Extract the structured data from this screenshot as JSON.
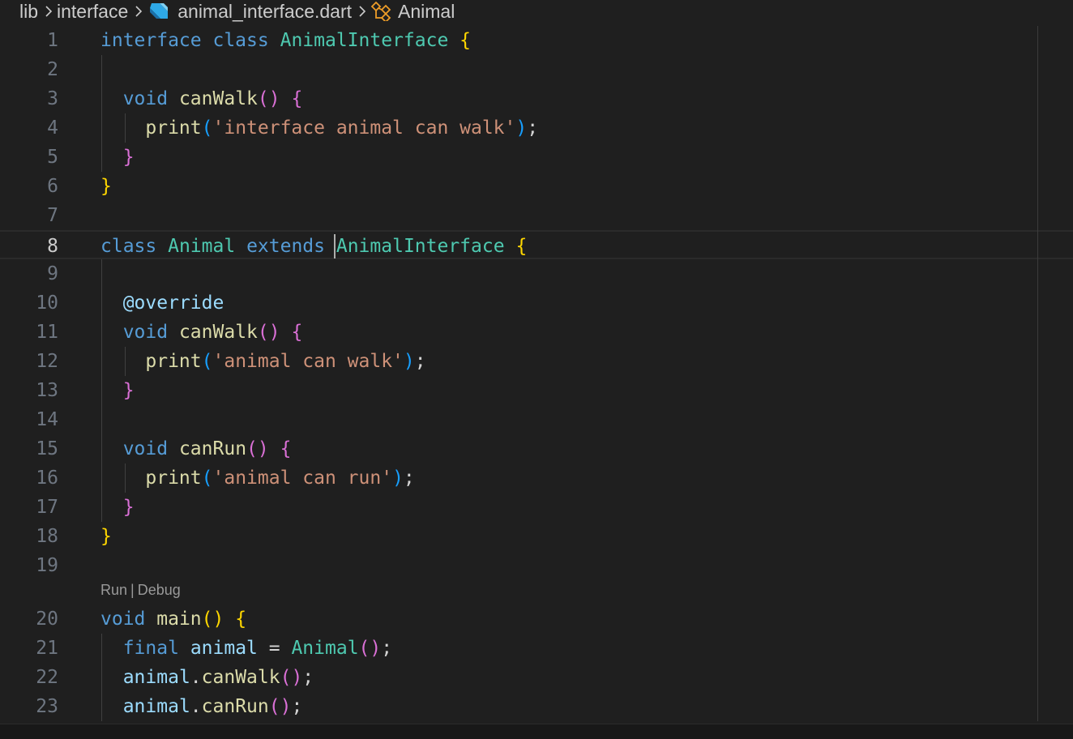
{
  "breadcrumb": {
    "items": [
      "lib",
      "interface",
      "animal_interface.dart",
      "Animal"
    ],
    "file_icon": "dart-file-icon",
    "symbol_icon": "class-symbol-icon",
    "icon_colors": {
      "dart": "#2ea8e6",
      "class": "#ee9d28"
    }
  },
  "editor": {
    "active_line": 8,
    "codelens": {
      "run": "Run",
      "separator": "|",
      "debug": "Debug"
    },
    "lines": [
      {
        "n": 1,
        "tokens": [
          [
            "kw",
            "interface"
          ],
          [
            "plain",
            " "
          ],
          [
            "kw",
            "class"
          ],
          [
            "plain",
            " "
          ],
          [
            "cls",
            "AnimalInterface"
          ],
          [
            "plain",
            " "
          ],
          [
            "b1",
            "{"
          ]
        ]
      },
      {
        "n": 2,
        "tokens": []
      },
      {
        "n": 3,
        "tokens": [
          [
            "plain",
            "  "
          ],
          [
            "kw",
            "void"
          ],
          [
            "plain",
            " "
          ],
          [
            "fn",
            "canWalk"
          ],
          [
            "b2",
            "()"
          ],
          [
            "plain",
            " "
          ],
          [
            "b2",
            "{"
          ]
        ]
      },
      {
        "n": 4,
        "tokens": [
          [
            "plain",
            "    "
          ],
          [
            "fn",
            "print"
          ],
          [
            "b3",
            "("
          ],
          [
            "str",
            "'interface animal can walk'"
          ],
          [
            "b3",
            ")"
          ],
          [
            "plain",
            ";"
          ]
        ]
      },
      {
        "n": 5,
        "tokens": [
          [
            "plain",
            "  "
          ],
          [
            "b2",
            "}"
          ]
        ]
      },
      {
        "n": 6,
        "tokens": [
          [
            "b1",
            "}"
          ]
        ]
      },
      {
        "n": 7,
        "tokens": []
      },
      {
        "n": 8,
        "tokens": [
          [
            "kw",
            "class"
          ],
          [
            "plain",
            " "
          ],
          [
            "cls",
            "Animal"
          ],
          [
            "plain",
            " "
          ],
          [
            "kw",
            "extends"
          ],
          [
            "plain",
            " "
          ],
          [
            "cls",
            "AnimalInterface"
          ],
          [
            "plain",
            " "
          ],
          [
            "b1",
            "{"
          ]
        ]
      },
      {
        "n": 9,
        "tokens": []
      },
      {
        "n": 10,
        "tokens": [
          [
            "plain",
            "  "
          ],
          [
            "ann",
            "@override"
          ]
        ]
      },
      {
        "n": 11,
        "tokens": [
          [
            "plain",
            "  "
          ],
          [
            "kw",
            "void"
          ],
          [
            "plain",
            " "
          ],
          [
            "fn",
            "canWalk"
          ],
          [
            "b2",
            "()"
          ],
          [
            "plain",
            " "
          ],
          [
            "b2",
            "{"
          ]
        ]
      },
      {
        "n": 12,
        "tokens": [
          [
            "plain",
            "    "
          ],
          [
            "fn",
            "print"
          ],
          [
            "b3",
            "("
          ],
          [
            "str",
            "'animal can walk'"
          ],
          [
            "b3",
            ")"
          ],
          [
            "plain",
            ";"
          ]
        ]
      },
      {
        "n": 13,
        "tokens": [
          [
            "plain",
            "  "
          ],
          [
            "b2",
            "}"
          ]
        ]
      },
      {
        "n": 14,
        "tokens": []
      },
      {
        "n": 15,
        "tokens": [
          [
            "plain",
            "  "
          ],
          [
            "kw",
            "void"
          ],
          [
            "plain",
            " "
          ],
          [
            "fn",
            "canRun"
          ],
          [
            "b2",
            "()"
          ],
          [
            "plain",
            " "
          ],
          [
            "b2",
            "{"
          ]
        ]
      },
      {
        "n": 16,
        "tokens": [
          [
            "plain",
            "    "
          ],
          [
            "fn",
            "print"
          ],
          [
            "b3",
            "("
          ],
          [
            "str",
            "'animal can run'"
          ],
          [
            "b3",
            ")"
          ],
          [
            "plain",
            ";"
          ]
        ]
      },
      {
        "n": 17,
        "tokens": [
          [
            "plain",
            "  "
          ],
          [
            "b2",
            "}"
          ]
        ]
      },
      {
        "n": 18,
        "tokens": [
          [
            "b1",
            "}"
          ]
        ]
      },
      {
        "n": 19,
        "tokens": []
      },
      {
        "n": 20,
        "tokens": [
          [
            "kw",
            "void"
          ],
          [
            "plain",
            " "
          ],
          [
            "fn",
            "main"
          ],
          [
            "b1",
            "()"
          ],
          [
            "plain",
            " "
          ],
          [
            "b1",
            "{"
          ]
        ]
      },
      {
        "n": 21,
        "tokens": [
          [
            "plain",
            "  "
          ],
          [
            "kw",
            "final"
          ],
          [
            "plain",
            " "
          ],
          [
            "var",
            "animal"
          ],
          [
            "plain",
            " = "
          ],
          [
            "cls",
            "Animal"
          ],
          [
            "b2",
            "()"
          ],
          [
            "plain",
            ";"
          ]
        ]
      },
      {
        "n": 22,
        "tokens": [
          [
            "plain",
            "  "
          ],
          [
            "var",
            "animal"
          ],
          [
            "plain",
            "."
          ],
          [
            "fn",
            "canWalk"
          ],
          [
            "b2",
            "()"
          ],
          [
            "plain",
            ";"
          ]
        ]
      },
      {
        "n": 23,
        "tokens": [
          [
            "plain",
            "  "
          ],
          [
            "var",
            "animal"
          ],
          [
            "plain",
            "."
          ],
          [
            "fn",
            "canRun"
          ],
          [
            "b2",
            "()"
          ],
          [
            "plain",
            ";"
          ]
        ]
      }
    ]
  }
}
